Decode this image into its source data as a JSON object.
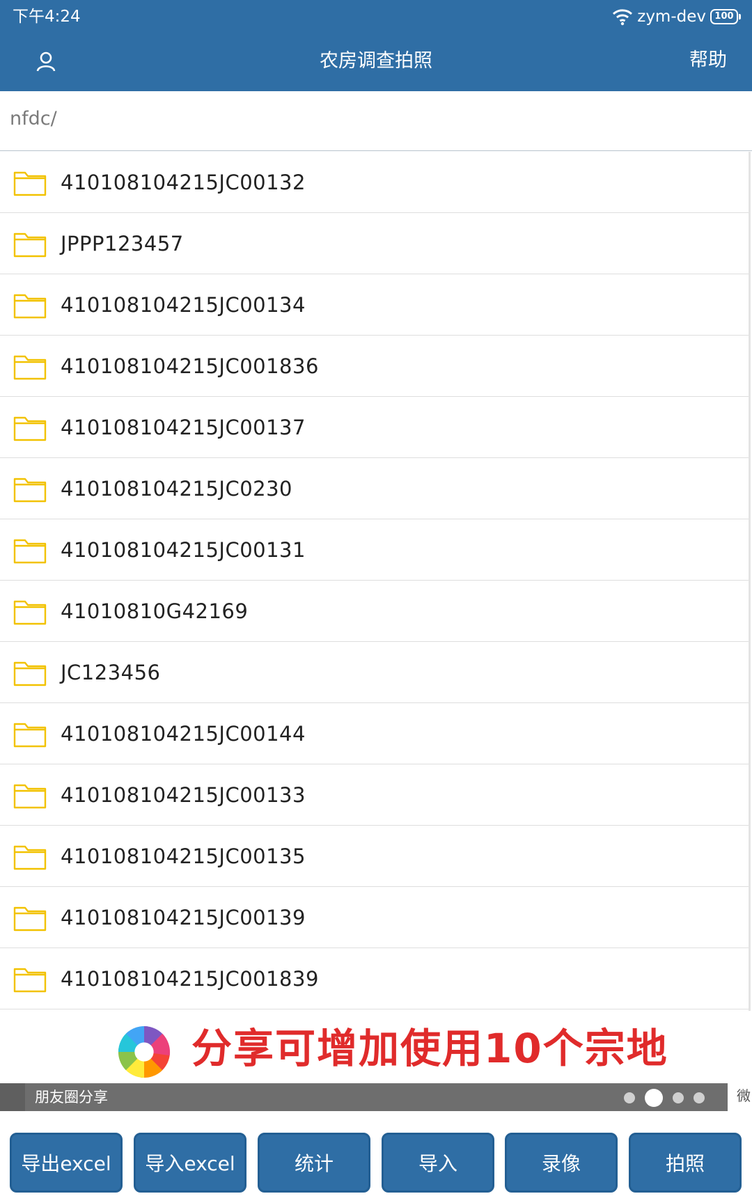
{
  "status_bar": {
    "time": "下午4:24",
    "network": "zym-dev",
    "battery": "100"
  },
  "app_bar": {
    "title": "农房调查拍照",
    "help": "帮助",
    "user_icon": "user-icon"
  },
  "path": "nfdc/",
  "files": [
    "410108104215JC00132",
    "JPPP123457",
    "410108104215JC00134",
    "410108104215JC001836",
    "410108104215JC00137",
    "410108104215JC0230",
    "410108104215JC00131",
    "41010810G42169",
    "JC123456",
    "410108104215JC00144",
    "410108104215JC00133",
    "410108104215JC00135",
    "410108104215JC00139",
    "410108104215JC001839"
  ],
  "ad": {
    "text": "分享可增加使用10个宗地",
    "color": "#e02b2b"
  },
  "share": {
    "label": "朋友圈分享",
    "wechat_label": "微",
    "page_count": 4,
    "active_page": 2
  },
  "buttons": {
    "export_excel": "导出excel",
    "import_excel": "导入excel",
    "stats": "统计",
    "import": "导入",
    "video": "录像",
    "photo": "拍照"
  },
  "colors": {
    "primary": "#2f6ea5",
    "folder": "#f2c200",
    "share_bar": "#6e6e6e"
  }
}
